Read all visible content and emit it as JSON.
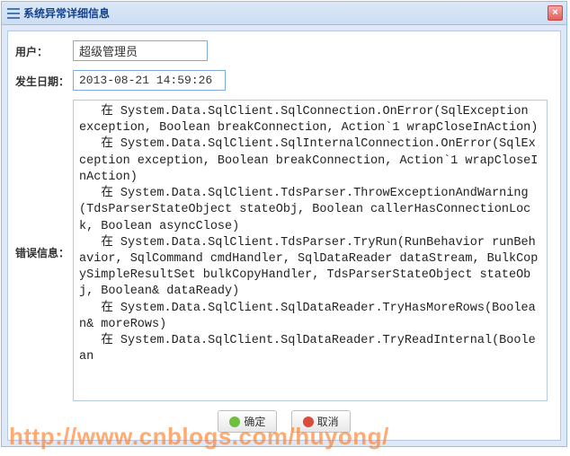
{
  "dialog": {
    "title": "系统异常详细信息",
    "close_symbol": "×"
  },
  "form": {
    "user_label": "用户：",
    "user_value": "超级管理员",
    "date_label": "发生日期：",
    "date_value": "2013-08-21 14:59:26",
    "error_label": "错误信息：",
    "error_value": "   在 System.Data.SqlClient.SqlConnection.OnError(SqlException exception, Boolean breakConnection, Action`1 wrapCloseInAction)\n   在 System.Data.SqlClient.SqlInternalConnection.OnError(SqlException exception, Boolean breakConnection, Action`1 wrapCloseInAction)\n   在 System.Data.SqlClient.TdsParser.ThrowExceptionAndWarning(TdsParserStateObject stateObj, Boolean callerHasConnectionLock, Boolean asyncClose)\n   在 System.Data.SqlClient.TdsParser.TryRun(RunBehavior runBehavior, SqlCommand cmdHandler, SqlDataReader dataStream, BulkCopySimpleResultSet bulkCopyHandler, TdsParserStateObject stateObj, Boolean& dataReady)\n   在 System.Data.SqlClient.SqlDataReader.TryHasMoreRows(Boolean& moreRows)\n   在 System.Data.SqlClient.SqlDataReader.TryReadInternal(Boolean"
  },
  "buttons": {
    "ok_label": "确定",
    "cancel_label": "取消"
  },
  "watermark": "http://www.cnblogs.com/huyong/"
}
